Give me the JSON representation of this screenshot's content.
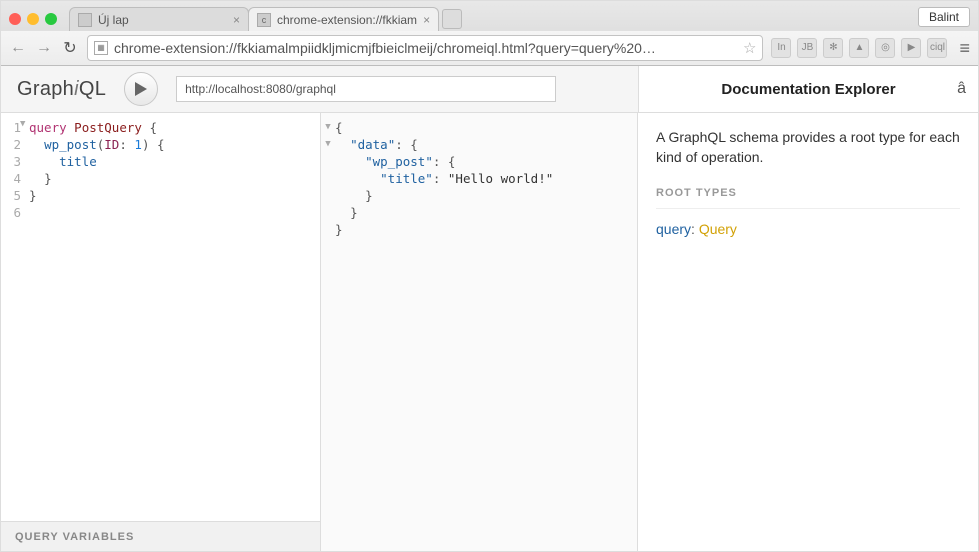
{
  "browser": {
    "profile": "Balint",
    "tabs": [
      {
        "title": "Új lap",
        "active": false
      },
      {
        "title": "chrome-extension://fkkiam",
        "active": true
      }
    ],
    "url": "chrome-extension://fkkiamalmpiidkljmicmjfbieiclmeij/chromeiql.html?query=query%20…",
    "ext_icons": [
      "In",
      "JB",
      "✻",
      "▲",
      "◎",
      "▶",
      "ciql"
    ]
  },
  "graphiql": {
    "logo_plain_a": "Graph",
    "logo_i": "i",
    "logo_plain_b": "QL",
    "endpoint": "http://localhost:8080/graphql",
    "query_lines": [
      "query PostQuery {",
      "  wp_post(ID: 1) {",
      "    title",
      "  }",
      "}",
      ""
    ],
    "query_line_numbers": [
      "1",
      "2",
      "3",
      "4",
      "5",
      "6"
    ],
    "result": {
      "data": {
        "wp_post": {
          "title": "Hello world!"
        }
      }
    },
    "variables_label": "QUERY VARIABLES"
  },
  "doc": {
    "title": "Documentation Explorer",
    "close_glyph": "â",
    "intro": "A GraphQL schema provides a root type for each kind of operation.",
    "root_types_label": "ROOT TYPES",
    "root_entry_name": "query",
    "root_entry_type": "Query"
  }
}
